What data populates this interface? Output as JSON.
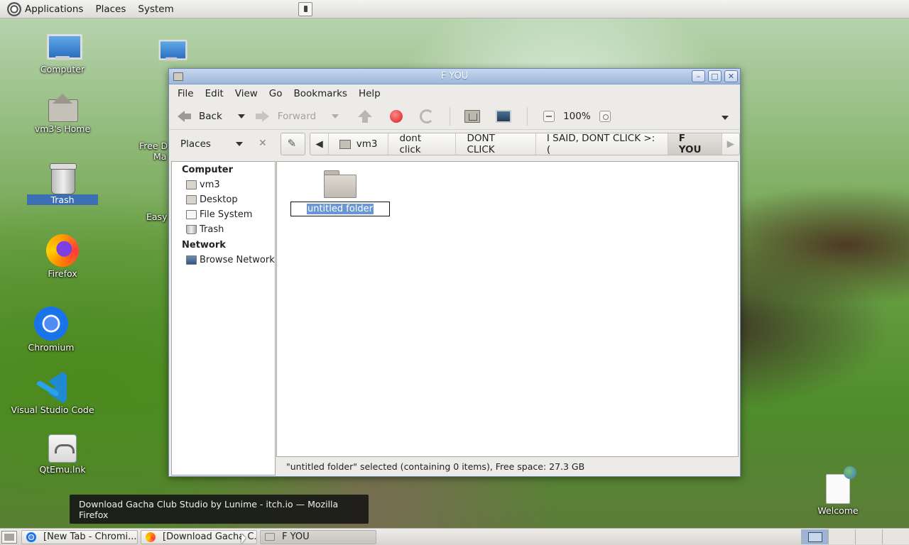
{
  "top_panel": {
    "menus": [
      "Applications",
      "Places",
      "System"
    ]
  },
  "desktop": {
    "icons": [
      {
        "label": "Computer",
        "icon": "computer-icon"
      },
      {
        "label": "vm3's Home",
        "icon": "home-folder-icon"
      },
      {
        "label": "Trash",
        "icon": "trash-icon",
        "selected": true
      },
      {
        "label": "Firefox",
        "icon": "firefox-icon"
      },
      {
        "label": "Chromium",
        "icon": "chromium-icon"
      },
      {
        "label": "Visual Studio Code",
        "icon": "vscode-icon"
      },
      {
        "label": "QtEmu.lnk",
        "icon": "qtemu-icon"
      },
      {
        "label": "Welcome",
        "icon": "document-icon"
      }
    ],
    "partial_labels": [
      "Free D",
      "Ma",
      "Easy"
    ]
  },
  "window": {
    "title": "F YOU",
    "menu": [
      "File",
      "Edit",
      "View",
      "Go",
      "Bookmarks",
      "Help"
    ],
    "toolbar": {
      "back": "Back",
      "forward": "Forward",
      "zoom": "100%"
    },
    "sidebar_selector": "Places",
    "breadcrumbs": [
      "vm3",
      "dont click",
      "DONT CLICK",
      "I SAID, DONT CLICK >:(",
      "F YOU"
    ],
    "sidebar": {
      "computer_heading": "Computer",
      "computer_items": [
        "vm3",
        "Desktop",
        "File System",
        "Trash"
      ],
      "network_heading": "Network",
      "network_items": [
        "Browse Network"
      ]
    },
    "content": {
      "rename_value": "untitled folder"
    },
    "status": "\"untitled folder\" selected (containing 0 items), Free space: 27.3 GB"
  },
  "tooltip": "Download Gacha Club Studio by Lunime - itch.io — Mozilla Firefox",
  "taskbar": {
    "tasks": [
      "[New Tab - Chromi...",
      "[Download Gacha C...",
      "F YOU"
    ]
  }
}
